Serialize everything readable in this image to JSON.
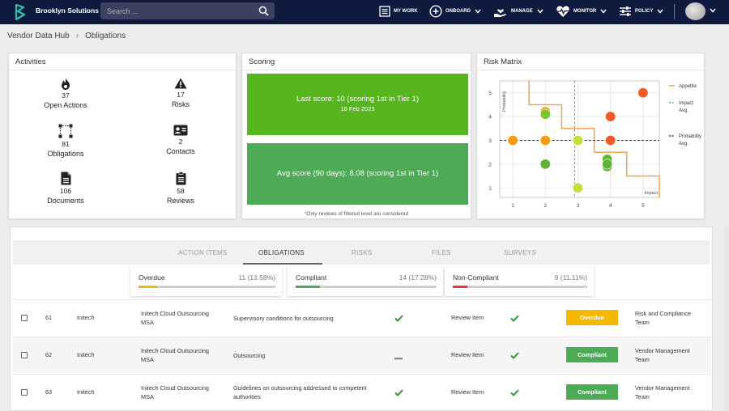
{
  "app": {
    "brand": "Brooklyn Solutions",
    "search_placeholder": "Search ...",
    "nav": [
      {
        "label": "MY WORK",
        "icon": "my-work-icon"
      },
      {
        "label": "ONBOARD",
        "icon": "plus-circle-icon"
      },
      {
        "label": "MANAGE",
        "icon": "hand-heart-icon"
      },
      {
        "label": "MONITOR",
        "icon": "heartbeat-icon"
      },
      {
        "label": "POLICY",
        "icon": "sliders-icon"
      }
    ]
  },
  "breadcrumb": [
    "Vendor Data Hub",
    "Obligations"
  ],
  "activities": {
    "title": "Activities",
    "items": [
      {
        "count": "37",
        "label": "Open Actions",
        "icon": "flame-icon"
      },
      {
        "count": "17",
        "label": "Risks",
        "icon": "warning-icon"
      },
      {
        "count": "81",
        "label": "Obligations",
        "icon": "flowchart-icon"
      },
      {
        "count": "2",
        "label": "Contacts",
        "icon": "contact-card-icon"
      },
      {
        "count": "106",
        "label": "Documents",
        "icon": "document-icon"
      },
      {
        "count": "58",
        "label": "Reviews",
        "icon": "clipboard-icon"
      }
    ]
  },
  "scoring": {
    "title": "Scoring",
    "last_score": "Last score: 10 (scoring 1st in Tier 1)",
    "last_date": "18 Feb 2023",
    "avg_score": "Avg score (90 days): 8.08 (scoring 1st in Tier 1)",
    "note": "*Only reviews of filtered level are considered"
  },
  "risk_matrix": {
    "title": "Risk Matrix",
    "legend": [
      "Appetite",
      "Impact Avg.",
      "Probability Avg."
    ],
    "colors": {
      "appetite": "#f39c3c",
      "impact": "#4aa8d8",
      "probability": "#2c3e70"
    }
  },
  "chart_data": {
    "type": "scatter",
    "title": "Risk Matrix",
    "xlabel": "Impact",
    "ylabel": "Probability",
    "xlim": [
      0.6,
      5.5
    ],
    "ylim": [
      0.6,
      5.5
    ],
    "xticks": [
      "1",
      "2",
      "3",
      "4",
      "5"
    ],
    "yticks": [
      "1",
      "2",
      "3",
      "4",
      "5"
    ],
    "impact_avg": 2.9,
    "probability_avg": 3,
    "appetite": [
      [
        1.5,
        5.5
      ],
      [
        1.5,
        4.5
      ],
      [
        2.5,
        4.5
      ],
      [
        2.5,
        3.5
      ],
      [
        3.5,
        3.5
      ],
      [
        3.5,
        2.5
      ],
      [
        4.5,
        2.5
      ],
      [
        4.5,
        1.5
      ],
      [
        5.5,
        1.5
      ],
      [
        5.5,
        0.6
      ]
    ],
    "points": [
      {
        "x": 1,
        "y": 3,
        "color": "#f39c12"
      },
      {
        "x": 2,
        "y": 4.2,
        "color": "#f39c12"
      },
      {
        "x": 2,
        "y": 4.1,
        "color": "#7cc42f"
      },
      {
        "x": 2,
        "y": 3,
        "color": "#f39c12"
      },
      {
        "x": 2,
        "y": 2,
        "color": "#62b33a"
      },
      {
        "x": 3,
        "y": 3,
        "color": "#c5dc3a"
      },
      {
        "x": 3,
        "y": 1,
        "color": "#c5dc3a"
      },
      {
        "x": 4,
        "y": 4,
        "color": "#f05a28"
      },
      {
        "x": 4,
        "y": 3,
        "color": "#f05a28"
      },
      {
        "x": 3.9,
        "y": 2.2,
        "color": "#62b33a"
      },
      {
        "x": 3.9,
        "y": 1.9,
        "color": "#62b33a"
      },
      {
        "x": 5,
        "y": 5,
        "color": "#f05a28"
      },
      {
        "x": 3.9,
        "y": 2.0,
        "color": "#62b33a"
      }
    ]
  },
  "tabs": [
    "ACTION ITEMS",
    "OBLIGATIONS",
    "RISKS",
    "FILES",
    "SURVEYS"
  ],
  "stats": [
    {
      "label": "Overdue",
      "count": "11 (13.58%)",
      "fraction": 0.1358,
      "color": "#f5b800"
    },
    {
      "label": "Compliant",
      "count": "14 (17.28%)",
      "fraction": 0.1728,
      "color": "#4cab54"
    },
    {
      "label": "Non-Compliant",
      "count": "9 (11.11%)",
      "fraction": 0.1111,
      "color": "#e53935"
    }
  ],
  "rows": [
    {
      "id": "61",
      "vendor": "Initech",
      "contract": [
        "Initech Cloud Outsourcing",
        "MSA"
      ],
      "obligation": [
        "Supervisory conditions for outsourcing"
      ],
      "check1": "check",
      "review": "Review Item",
      "check2": "check",
      "status": "Overdue",
      "status_color": "#f5b800",
      "owner": [
        "Risk and Compliance",
        "Team"
      ]
    },
    {
      "id": "62",
      "vendor": "Initech",
      "contract": [
        "Initech Cloud Outsourcing",
        "MSA"
      ],
      "obligation": [
        "Outsourcing"
      ],
      "check1": "dash",
      "review": "Review Item",
      "check2": "check",
      "status": "Compliant",
      "status_color": "#4cab54",
      "owner": [
        "Vendor Management",
        "Team"
      ]
    },
    {
      "id": "63",
      "vendor": "Initech",
      "contract": [
        "Initech Cloud Outsourcing",
        "MSA"
      ],
      "obligation": [
        "Guidelines on outsourcing addressed to competent",
        "authorities"
      ],
      "check1": "check",
      "review": "Review Item",
      "check2": "check",
      "status": "Compliant",
      "status_color": "#4cab54",
      "owner": [
        "Vendor Management",
        "Team"
      ]
    }
  ]
}
